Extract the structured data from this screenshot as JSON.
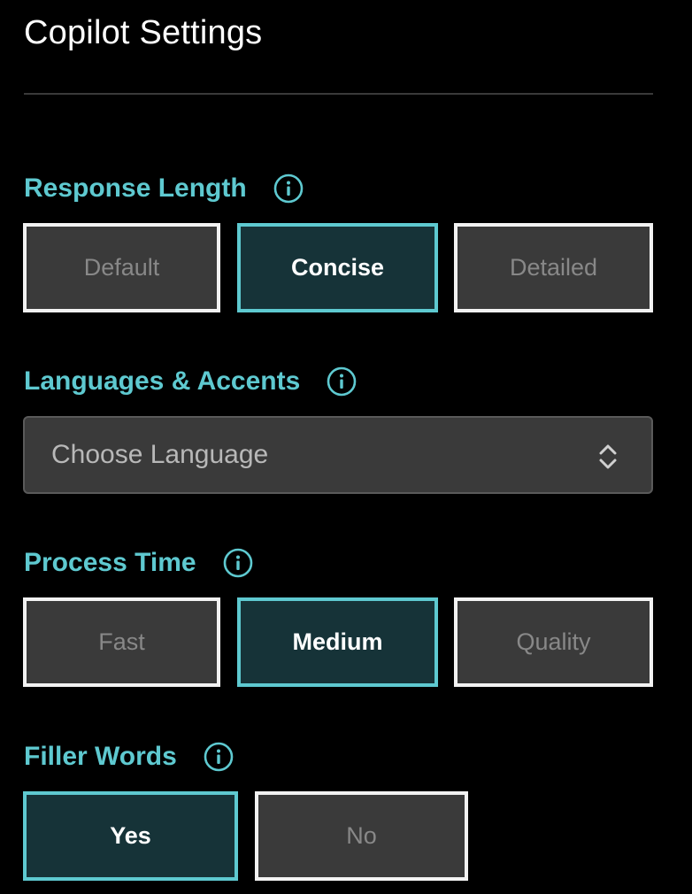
{
  "title": "Copilot Settings",
  "colors": {
    "accent": "#5ec9d0",
    "selected_bg": "#163338",
    "option_bg": "#3a3a3a",
    "background": "#000000"
  },
  "response_length": {
    "label": "Response Length",
    "info_icon": "info-icon",
    "options": [
      "Default",
      "Concise",
      "Detailed"
    ],
    "selected": "Concise"
  },
  "languages": {
    "label": "Languages & Accents",
    "info_icon": "info-icon",
    "placeholder": "Choose Language",
    "chevron_icon": "chevron-up-down-icon"
  },
  "process_time": {
    "label": "Process Time",
    "info_icon": "info-icon",
    "options": [
      "Fast",
      "Medium",
      "Quality"
    ],
    "selected": "Medium"
  },
  "filler_words": {
    "label": "Filler Words",
    "info_icon": "info-icon",
    "options": [
      "Yes",
      "No"
    ],
    "selected": "Yes"
  }
}
